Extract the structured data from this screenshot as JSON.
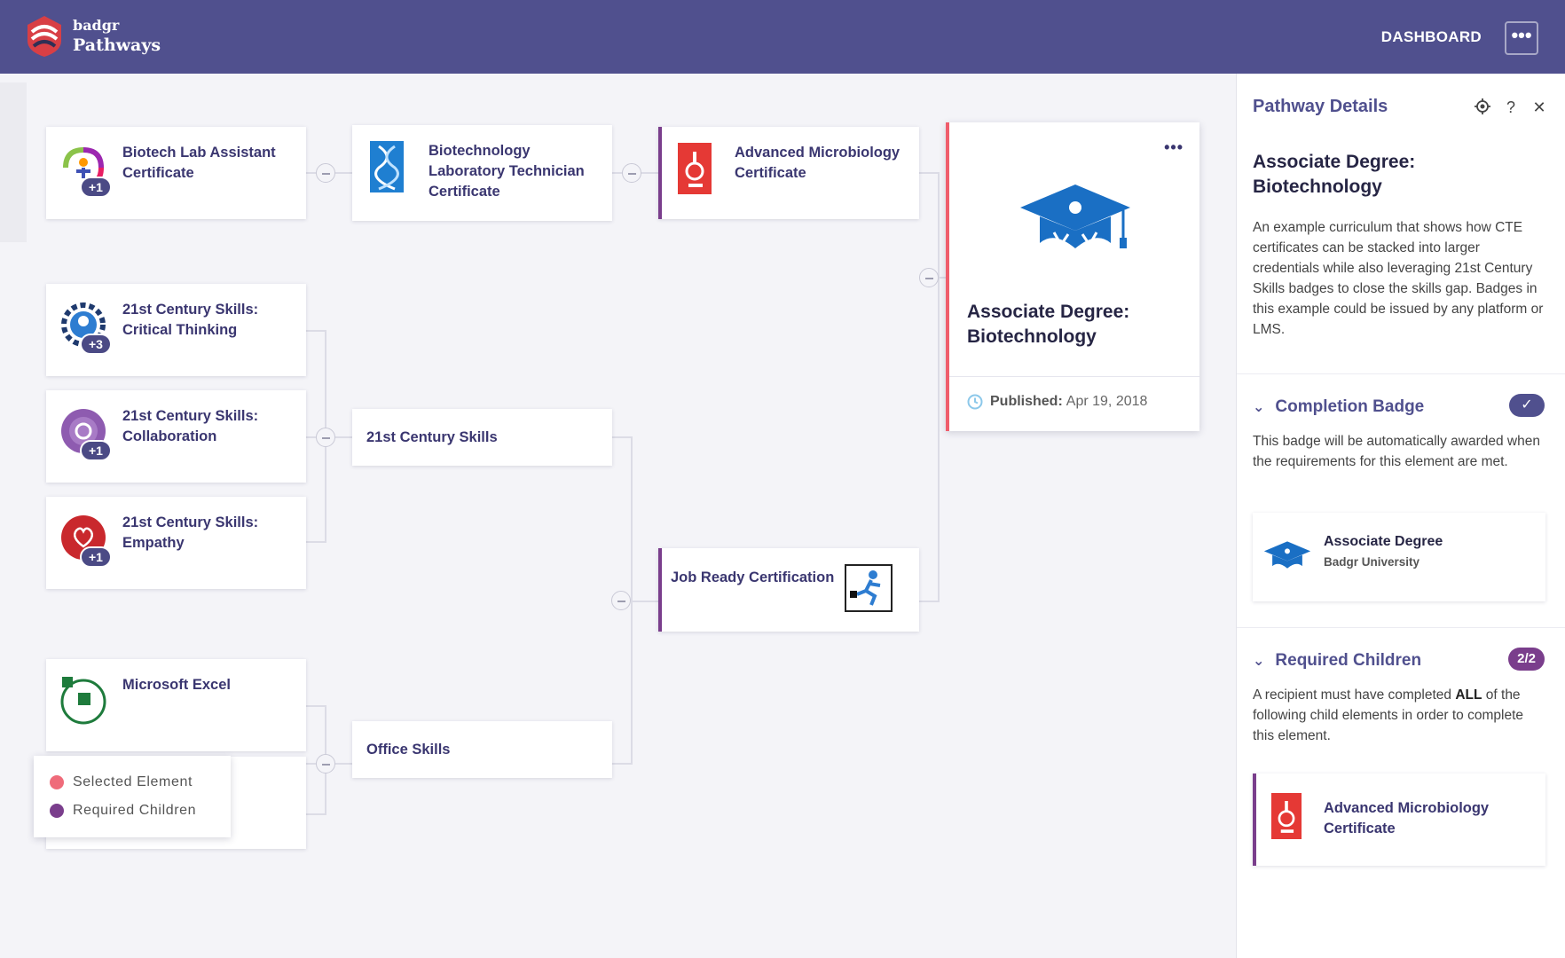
{
  "header": {
    "logo_small": "badgr",
    "logo_big": "Pathways",
    "nav_dashboard": "DASHBOARD",
    "menu_glyph": "•••",
    "color": "#50508e"
  },
  "cards": {
    "biotech_lab": {
      "title_l1": "Biotech Lab Assistant",
      "title_l2": "Certificate",
      "plus": "+1",
      "icon": "biotech-lab-badge-icon"
    },
    "biotech_tech": {
      "title_l1": "Biotechnology",
      "title_l2": "Laboratory Technician",
      "title_l3": "Certificate",
      "icon": "dna-icon"
    },
    "adv_micro": {
      "title_l1": "Advanced Microbiology",
      "title_l2": "Certificate",
      "icon": "microscope-icon"
    },
    "critical": {
      "title_l1": "21st Century Skills:",
      "title_l2": "Critical Thinking",
      "plus": "+3",
      "icon": "gear-head-badge-icon"
    },
    "collab": {
      "title_l1": "21st Century Skills:",
      "title_l2": "Collaboration",
      "plus": "+1",
      "icon": "collaboration-badge-icon"
    },
    "empathy": {
      "title_l1": "21st Century Skills:",
      "title_l2": "Empathy",
      "plus": "+1",
      "icon": "heart-badge-icon"
    },
    "skills_group": {
      "title": "21st Century Skills"
    },
    "job_ready": {
      "title": "Job Ready Certification",
      "icon": "runner-icon"
    },
    "excel": {
      "title": "Microsoft Excel",
      "icon": "excel-badge-icon"
    },
    "office": {
      "title": "Office Skills"
    }
  },
  "main_card": {
    "menu": "•••",
    "title_l1": "Associate Degree:",
    "title_l2": "Biotechnology",
    "published_label": "Published:",
    "published_date": "Apr 19, 2018",
    "accent": "#ef5d6c"
  },
  "legend": {
    "selected": "Selected Element",
    "required": "Required Children",
    "selected_color": "#ef6b7a",
    "required_color": "#7a3e8c"
  },
  "panel": {
    "heading": "Pathway Details",
    "icons": [
      "target-icon",
      "help-icon",
      "close-icon"
    ],
    "help_glyph": "?",
    "close_glyph": "✕",
    "title_l1": "Associate Degree:",
    "title_l2": "Biotechnology",
    "description": "An example curriculum that shows how CTE certificates can be stacked into larger credentials while also leveraging 21st Century Skills badges to close the skills gap. Badges in this example could be issued by any platform or LMS.",
    "completion": {
      "label": "Completion Badge",
      "check": "✓",
      "text": "This badge will be automatically awarded when the requirements for this element are met.",
      "badge_title": "Associate Degree",
      "badge_issuer": "Badgr University"
    },
    "required": {
      "label": "Required Children",
      "count": "2/2",
      "text_a": "A recipient must have completed ",
      "text_bold": "ALL",
      "text_b": " of the following child elements in order to complete this element.",
      "child_l1": "Advanced Microbiology",
      "child_l2": "Certificate"
    }
  }
}
